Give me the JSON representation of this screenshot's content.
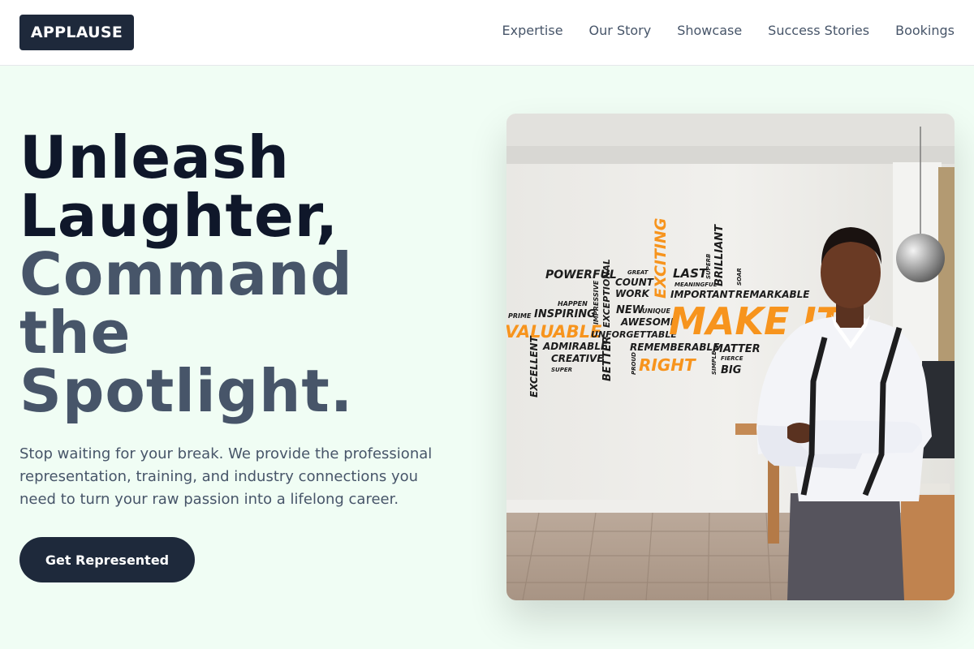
{
  "header": {
    "logo": "APPLAUSE",
    "nav": [
      {
        "label": "Expertise"
      },
      {
        "label": "Our Story"
      },
      {
        "label": "Showcase"
      },
      {
        "label": "Success Stories"
      },
      {
        "label": "Bookings"
      }
    ]
  },
  "hero": {
    "title_line_1": "Unleash Laughter,",
    "title_line_2": "Command the Spotlight.",
    "subtitle": "Stop waiting for your break. We provide the professional representation, training, and industry connections you need to turn your raw passion into a lifelong career.",
    "cta_label": "Get Represented"
  },
  "image": {
    "words": {
      "powerful": "POWERFUL",
      "great": "GREAT",
      "count": "COUNT",
      "work": "WORK",
      "exciting": "EXCITING",
      "last": "LAST",
      "meaningful": "MEANINGFUL",
      "important": "IMPORTANT",
      "superb": "SUPERB",
      "brilliant": "BRILLIANT",
      "soar": "SOAR",
      "remarkable": "REMARKABLE",
      "happen": "HAPPEN",
      "impressive": "IMPRESSIVE",
      "exceptional": "EXCEPTIONAL",
      "new": "NEW",
      "unique": "UNIQUE",
      "awesome": "AWESOME",
      "prime": "PRIME",
      "inspiring": "INSPIRING",
      "valuable": "VALUABLE",
      "unforgettable": "UNFORGETTABLE",
      "make_it": "MAKE IT",
      "admirable": "ADMIRABLE",
      "excellent": "EXCELLENT",
      "creative": "CREATIVE",
      "super": "SUPER",
      "better": "BETTER",
      "rememberable": "REMEMBERABLE",
      "proud": "PROUD",
      "right": "RIGHT",
      "matter": "MATTER",
      "simple": "SIMPLE",
      "fierce": "FIERCE",
      "big": "BIG"
    }
  },
  "colors": {
    "page_bg": "#f0fdf4",
    "navy": "#1e293b",
    "slate": "#475569",
    "accent_orange": "#f7941d"
  }
}
